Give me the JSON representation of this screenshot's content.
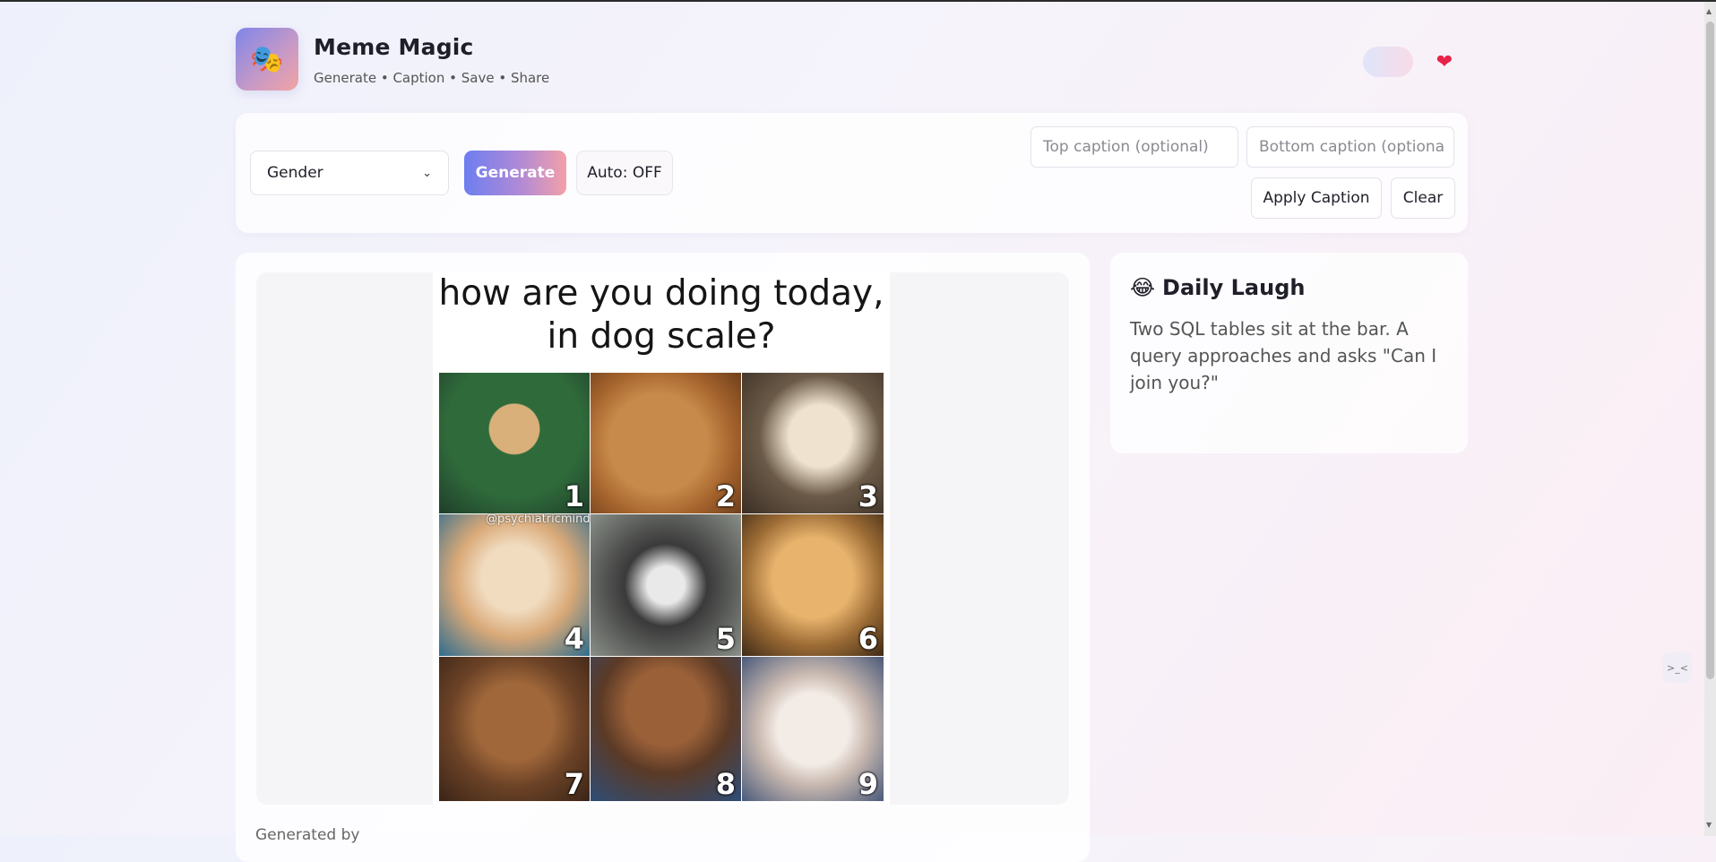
{
  "app": {
    "title": "Meme Magic",
    "subtitle": "Generate • Caption • Save • Share",
    "logo_icon": "🎭",
    "heart_icon": "❤"
  },
  "toolbar": {
    "category_value": "Gender",
    "generate_label": "Generate",
    "auto_label": "Auto: OFF",
    "top_caption_placeholder": "Top caption (optional)",
    "bottom_caption_placeholder": "Bottom caption (optiona",
    "apply_label": "Apply Caption",
    "clear_label": "Clear"
  },
  "meme": {
    "caption": "how are you doing today, in dog scale?",
    "watermark": "@psychiatricmind",
    "tiles": [
      "1",
      "2",
      "3",
      "4",
      "5",
      "6",
      "7",
      "8",
      "9"
    ],
    "below_text": "Generated by"
  },
  "daily": {
    "emoji": "😂",
    "title": "Daily Laugh",
    "joke": "Two SQL tables sit at the bar. A query approaches and asks \"Can I join you?\""
  },
  "colors": {
    "accent_start": "#6d7ef0",
    "accent_end": "#f3a0a8",
    "heart": "#e8234a"
  }
}
